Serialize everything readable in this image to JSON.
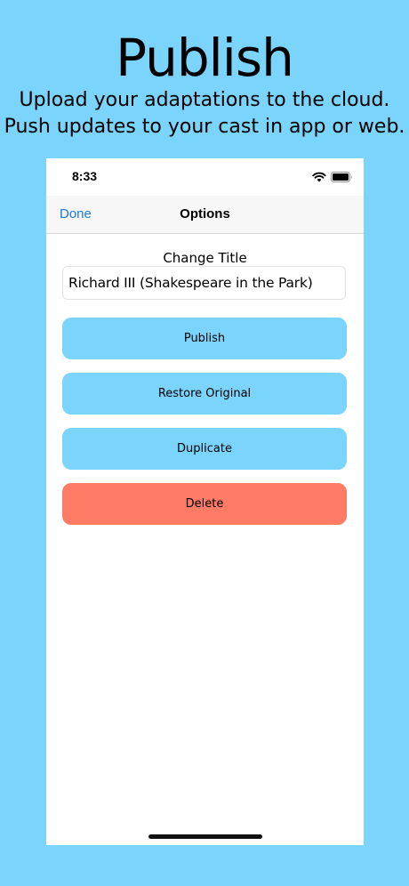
{
  "promo": {
    "headline": "Publish",
    "subline_1": "Upload your adaptations to the cloud.",
    "subline_2": "Push updates to your cast in app or web."
  },
  "status_bar": {
    "time": "8:33",
    "icons": [
      "wifi-icon",
      "battery-icon"
    ]
  },
  "nav": {
    "done_label": "Done",
    "title": "Options"
  },
  "form": {
    "title_label": "Change Title",
    "title_value": "Richard III (Shakespeare in the Park)"
  },
  "actions": {
    "publish_label": "Publish",
    "restore_label": "Restore Original",
    "duplicate_label": "Duplicate",
    "delete_label": "Delete"
  },
  "colors": {
    "background": "#7ad4fc",
    "button": "#7ad4fc",
    "delete_button": "#fe7b65",
    "link": "#1a7ae6"
  }
}
